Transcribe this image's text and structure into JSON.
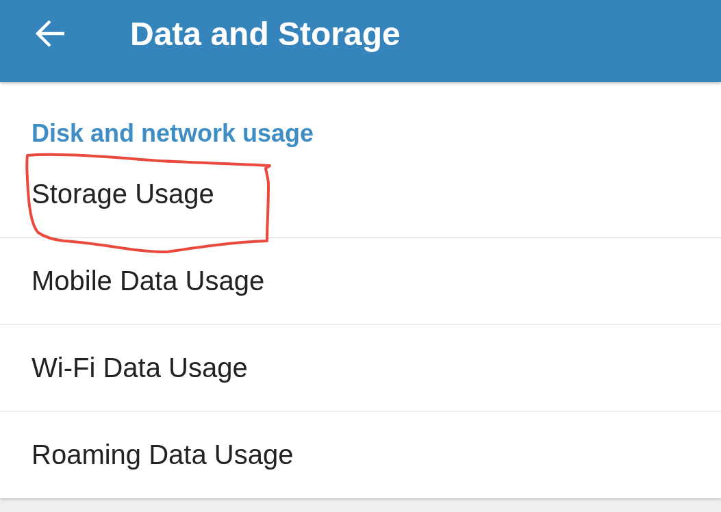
{
  "app_bar": {
    "title": "Data and Storage"
  },
  "section": {
    "heading": "Disk and network usage",
    "items": [
      {
        "label": "Storage Usage",
        "circled": true
      },
      {
        "label": "Mobile Data Usage",
        "circled": false
      },
      {
        "label": "Wi-Fi Data Usage",
        "circled": false
      },
      {
        "label": "Roaming Data Usage",
        "circled": false
      }
    ]
  }
}
